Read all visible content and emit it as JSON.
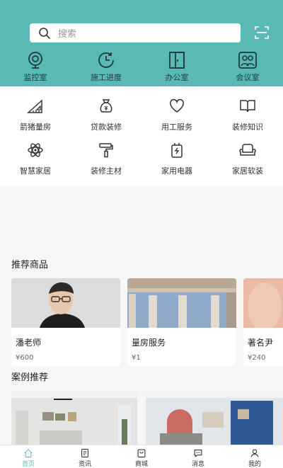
{
  "search": {
    "placeholder": "搜索"
  },
  "top_nav": [
    {
      "label": "监控室",
      "icon": "camera-icon"
    },
    {
      "label": "施工进度",
      "icon": "clock-refresh-icon"
    },
    {
      "label": "办公室",
      "icon": "door-icon"
    },
    {
      "label": "会议室",
      "icon": "meeting-icon"
    }
  ],
  "services": [
    {
      "label": "箭猪量房",
      "icon": "ruler-icon"
    },
    {
      "label": "贷款装修",
      "icon": "money-bag-icon"
    },
    {
      "label": "用工服务",
      "icon": "heart-icon"
    },
    {
      "label": "装修知识",
      "icon": "book-icon"
    },
    {
      "label": "智慧家居",
      "icon": "atom-icon"
    },
    {
      "label": "装修主材",
      "icon": "paint-roller-icon"
    },
    {
      "label": "家用电器",
      "icon": "charger-icon"
    },
    {
      "label": "家居软装",
      "icon": "sofa-icon"
    }
  ],
  "recommended": {
    "title": "推荐商品",
    "items": [
      {
        "name": "潘老师",
        "price": "¥600"
      },
      {
        "name": "量房服务",
        "price": "¥1"
      },
      {
        "name": "著名尹",
        "price": "¥240"
      }
    ]
  },
  "cases": {
    "title": "案例推荐"
  },
  "tabbar": [
    {
      "label": "首页",
      "icon": "home-icon"
    },
    {
      "label": "资讯",
      "icon": "document-icon"
    },
    {
      "label": "商城",
      "icon": "shopping-bag-icon"
    },
    {
      "label": "消息",
      "icon": "chat-icon"
    },
    {
      "label": "我的",
      "icon": "user-icon"
    }
  ],
  "colors": {
    "primary": "#5bb9b5",
    "icon_dark": "#1d3b3a"
  }
}
